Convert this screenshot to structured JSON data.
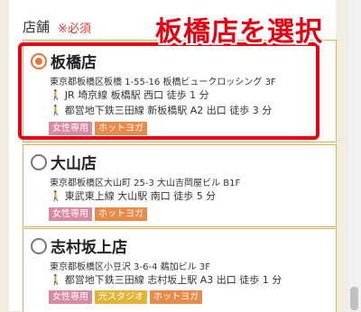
{
  "form": {
    "field_label": "店舗",
    "required_label": "※必須"
  },
  "annotation": "板橋店を選択",
  "stores": [
    {
      "name": "板橋店",
      "address": "東京都板橋区板橋 1-55-16 板橋ビュークロッシング 3F",
      "access": [
        "JR 埼京線 板橋駅 西口 徒歩 1 分",
        "都営地下鉄三田線 新板橋駅 A2 出口 徒歩 3 分"
      ],
      "tags": [
        "女性専用",
        "ホットヨガ"
      ],
      "selected": true
    },
    {
      "name": "大山店",
      "address": "東京都板橋区大山町 25-3 大山吉岡屋ビル B1F",
      "access": [
        "東武東上線 大山駅 南口 徒歩 5 分"
      ],
      "tags": [
        "女性専用",
        "ホットヨガ"
      ],
      "selected": false
    },
    {
      "name": "志村坂上店",
      "address": "東京都板橋区小豆沢 3-6-4 鵜加ビル 3F",
      "access": [
        "都営地下鉄三田線 志村坂上駅 A3 出口 徒歩 1 分"
      ],
      "tags": [
        "女性専用",
        "光スタジオ",
        "ホットヨガ"
      ],
      "selected": false
    }
  ],
  "colors": {
    "accent": "#e8743a",
    "highlight": "#e50012",
    "border": "#d9b25a",
    "tag_pink": "#d98aa3",
    "tag_orange": "#e88a4a",
    "tag_yellow": "#e2b436"
  }
}
